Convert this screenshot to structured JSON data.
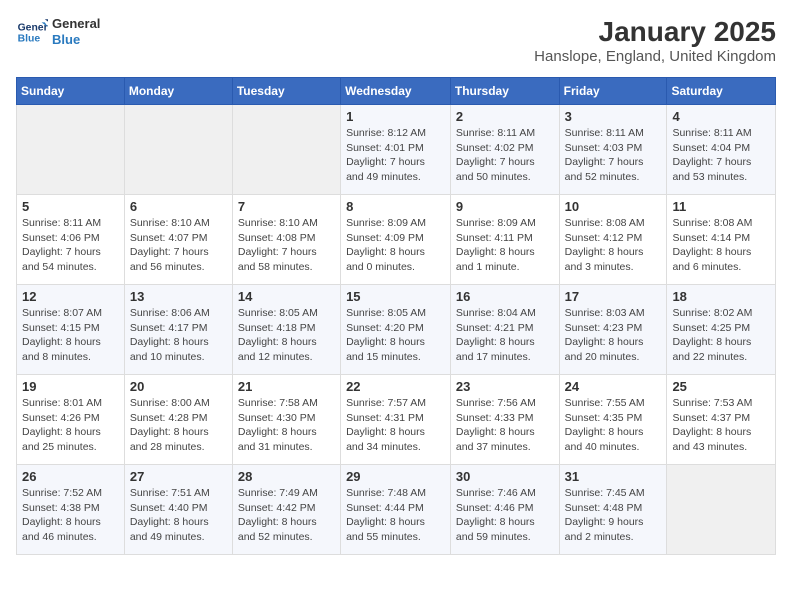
{
  "header": {
    "logo_line1": "General",
    "logo_line2": "Blue",
    "title": "January 2025",
    "subtitle": "Hanslope, England, United Kingdom"
  },
  "weekdays": [
    "Sunday",
    "Monday",
    "Tuesday",
    "Wednesday",
    "Thursday",
    "Friday",
    "Saturday"
  ],
  "weeks": [
    [
      {
        "day": "",
        "info": ""
      },
      {
        "day": "",
        "info": ""
      },
      {
        "day": "",
        "info": ""
      },
      {
        "day": "1",
        "info": "Sunrise: 8:12 AM\nSunset: 4:01 PM\nDaylight: 7 hours and 49 minutes."
      },
      {
        "day": "2",
        "info": "Sunrise: 8:11 AM\nSunset: 4:02 PM\nDaylight: 7 hours and 50 minutes."
      },
      {
        "day": "3",
        "info": "Sunrise: 8:11 AM\nSunset: 4:03 PM\nDaylight: 7 hours and 52 minutes."
      },
      {
        "day": "4",
        "info": "Sunrise: 8:11 AM\nSunset: 4:04 PM\nDaylight: 7 hours and 53 minutes."
      }
    ],
    [
      {
        "day": "5",
        "info": "Sunrise: 8:11 AM\nSunset: 4:06 PM\nDaylight: 7 hours and 54 minutes."
      },
      {
        "day": "6",
        "info": "Sunrise: 8:10 AM\nSunset: 4:07 PM\nDaylight: 7 hours and 56 minutes."
      },
      {
        "day": "7",
        "info": "Sunrise: 8:10 AM\nSunset: 4:08 PM\nDaylight: 7 hours and 58 minutes."
      },
      {
        "day": "8",
        "info": "Sunrise: 8:09 AM\nSunset: 4:09 PM\nDaylight: 8 hours and 0 minutes."
      },
      {
        "day": "9",
        "info": "Sunrise: 8:09 AM\nSunset: 4:11 PM\nDaylight: 8 hours and 1 minute."
      },
      {
        "day": "10",
        "info": "Sunrise: 8:08 AM\nSunset: 4:12 PM\nDaylight: 8 hours and 3 minutes."
      },
      {
        "day": "11",
        "info": "Sunrise: 8:08 AM\nSunset: 4:14 PM\nDaylight: 8 hours and 6 minutes."
      }
    ],
    [
      {
        "day": "12",
        "info": "Sunrise: 8:07 AM\nSunset: 4:15 PM\nDaylight: 8 hours and 8 minutes."
      },
      {
        "day": "13",
        "info": "Sunrise: 8:06 AM\nSunset: 4:17 PM\nDaylight: 8 hours and 10 minutes."
      },
      {
        "day": "14",
        "info": "Sunrise: 8:05 AM\nSunset: 4:18 PM\nDaylight: 8 hours and 12 minutes."
      },
      {
        "day": "15",
        "info": "Sunrise: 8:05 AM\nSunset: 4:20 PM\nDaylight: 8 hours and 15 minutes."
      },
      {
        "day": "16",
        "info": "Sunrise: 8:04 AM\nSunset: 4:21 PM\nDaylight: 8 hours and 17 minutes."
      },
      {
        "day": "17",
        "info": "Sunrise: 8:03 AM\nSunset: 4:23 PM\nDaylight: 8 hours and 20 minutes."
      },
      {
        "day": "18",
        "info": "Sunrise: 8:02 AM\nSunset: 4:25 PM\nDaylight: 8 hours and 22 minutes."
      }
    ],
    [
      {
        "day": "19",
        "info": "Sunrise: 8:01 AM\nSunset: 4:26 PM\nDaylight: 8 hours and 25 minutes."
      },
      {
        "day": "20",
        "info": "Sunrise: 8:00 AM\nSunset: 4:28 PM\nDaylight: 8 hours and 28 minutes."
      },
      {
        "day": "21",
        "info": "Sunrise: 7:58 AM\nSunset: 4:30 PM\nDaylight: 8 hours and 31 minutes."
      },
      {
        "day": "22",
        "info": "Sunrise: 7:57 AM\nSunset: 4:31 PM\nDaylight: 8 hours and 34 minutes."
      },
      {
        "day": "23",
        "info": "Sunrise: 7:56 AM\nSunset: 4:33 PM\nDaylight: 8 hours and 37 minutes."
      },
      {
        "day": "24",
        "info": "Sunrise: 7:55 AM\nSunset: 4:35 PM\nDaylight: 8 hours and 40 minutes."
      },
      {
        "day": "25",
        "info": "Sunrise: 7:53 AM\nSunset: 4:37 PM\nDaylight: 8 hours and 43 minutes."
      }
    ],
    [
      {
        "day": "26",
        "info": "Sunrise: 7:52 AM\nSunset: 4:38 PM\nDaylight: 8 hours and 46 minutes."
      },
      {
        "day": "27",
        "info": "Sunrise: 7:51 AM\nSunset: 4:40 PM\nDaylight: 8 hours and 49 minutes."
      },
      {
        "day": "28",
        "info": "Sunrise: 7:49 AM\nSunset: 4:42 PM\nDaylight: 8 hours and 52 minutes."
      },
      {
        "day": "29",
        "info": "Sunrise: 7:48 AM\nSunset: 4:44 PM\nDaylight: 8 hours and 55 minutes."
      },
      {
        "day": "30",
        "info": "Sunrise: 7:46 AM\nSunset: 4:46 PM\nDaylight: 8 hours and 59 minutes."
      },
      {
        "day": "31",
        "info": "Sunrise: 7:45 AM\nSunset: 4:48 PM\nDaylight: 9 hours and 2 minutes."
      },
      {
        "day": "",
        "info": ""
      }
    ]
  ]
}
